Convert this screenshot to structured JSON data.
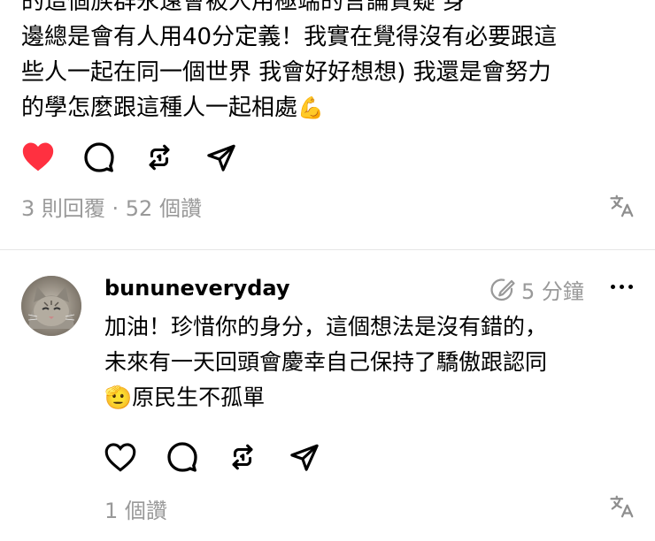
{
  "post": {
    "lines": [
      "的這個族群永遠會被人用極端的言論質疑 身",
      "邊總是會有人用40分定義！我實在覺得沒有必要跟這",
      "些人一起在同一個世界 我會好好想想) 我還是會努力",
      "的學怎麼跟這種人一起相處"
    ],
    "flex_emoji": "💪",
    "meta": "3 則回覆 · 52 個讚",
    "liked": true
  },
  "reply": {
    "username": "bununeveryday",
    "time": "5 分鐘",
    "lines": [
      "加油！珍惜你的身分，這個想法是沒有錯的，",
      "未來有一天回頭會慶幸自己保持了驕傲跟認同",
      "原民生不孤單"
    ],
    "salute_emoji": "🫡",
    "meta": "1 個讚",
    "liked": false
  },
  "colors": {
    "like_red": "#ff3040",
    "muted_text": "#999999",
    "divider": "#e6e6e6"
  },
  "icons": [
    "heart-icon",
    "comment-icon",
    "repost-icon",
    "share-icon",
    "translate-icon",
    "edit-time-icon",
    "more-icon"
  ]
}
